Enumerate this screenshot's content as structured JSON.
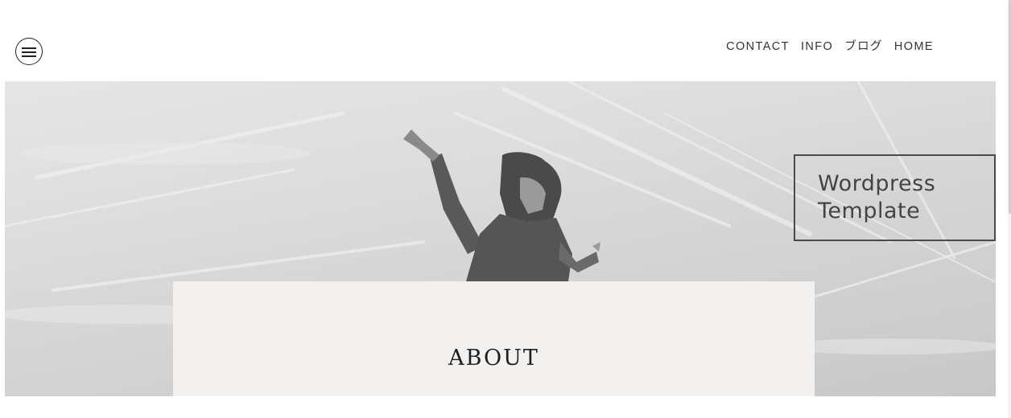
{
  "header": {
    "menu_icon": "hamburger-menu-icon",
    "nav": [
      {
        "label": "CONTACT"
      },
      {
        "label": "INFO"
      },
      {
        "label": "ブログ"
      },
      {
        "label": "HOME"
      }
    ]
  },
  "hero": {
    "brand_title": "Wordpress\nTemplate",
    "image_subject": "hooded-figure-sky-photo"
  },
  "about": {
    "title": "ABOUT"
  },
  "colors": {
    "text": "#333333",
    "card_bg": "#f2f1ef",
    "border": "#4a4a4a"
  }
}
